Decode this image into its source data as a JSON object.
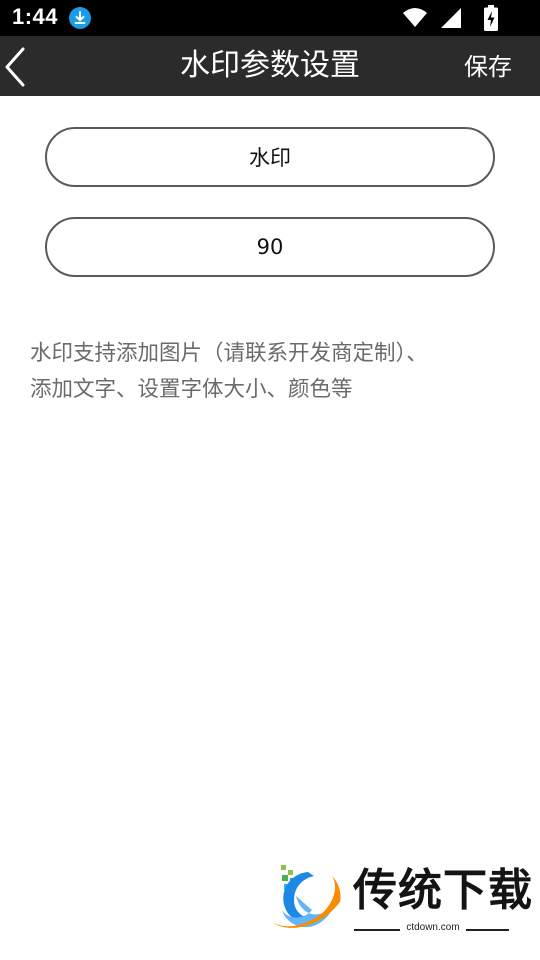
{
  "status_bar": {
    "time": "1:44",
    "icons": [
      "download-badge-icon",
      "wifi-icon",
      "cell-signal-icon",
      "battery-charging-icon"
    ]
  },
  "app_bar": {
    "back_icon": "chevron-left-icon",
    "title": "水印参数设置",
    "save_label": "保存"
  },
  "form": {
    "watermark_text": "水印",
    "rotation_value": "90"
  },
  "hint": {
    "line1": "水印支持添加图片（请联系开发商定制）、",
    "line2": "添加文字、设置字体大小、颜色等"
  },
  "watermark": {
    "brand": "传统下载",
    "url": "ctdown.com"
  },
  "colors": {
    "status_bar_bg": "#000000",
    "app_bar_bg": "#2b2b2b",
    "field_border": "#5a5a5a",
    "hint_text": "#6b6b6b",
    "download_badge": "#1a9be6"
  }
}
